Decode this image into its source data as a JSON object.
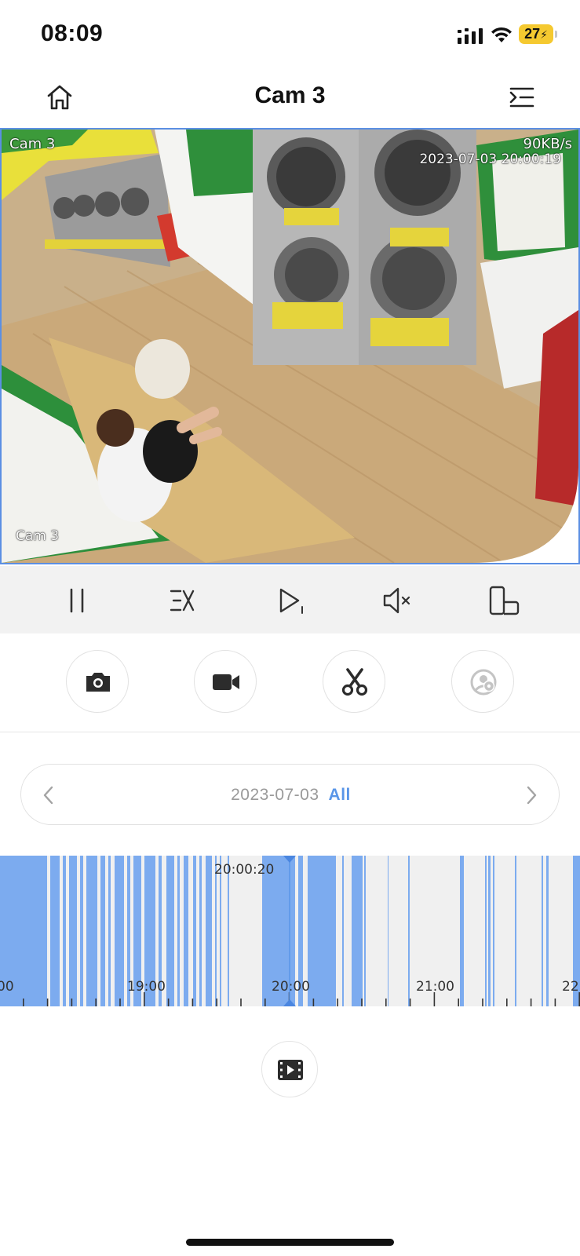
{
  "status_bar": {
    "time": "08:09",
    "battery_level": "27",
    "battery_color": "#f5c930",
    "icons": [
      "cellular-signal-icon",
      "wifi-icon",
      "battery-charging-icon"
    ]
  },
  "nav": {
    "title": "Cam 3",
    "left_icon": "home-icon",
    "right_icon": "menu-icon"
  },
  "camera": {
    "label_top_left": "Cam 3",
    "bitrate": "90KB/s",
    "timestamp": "2023-07-03 20:00:19",
    "label_bottom_left": "Cam 3",
    "border_color": "#5b8fe3"
  },
  "playback_controls": [
    {
      "name": "pause-icon"
    },
    {
      "name": "speed-icon"
    },
    {
      "name": "play-step-icon"
    },
    {
      "name": "mute-icon"
    },
    {
      "name": "rotate-screen-icon"
    }
  ],
  "tools": [
    {
      "name": "snapshot-camera-icon"
    },
    {
      "name": "record-video-icon"
    },
    {
      "name": "clip-scissors-icon"
    },
    {
      "name": "privacy-eye-icon",
      "disabled": true
    }
  ],
  "date_selector": {
    "date": "2023-07-03",
    "filter": "All",
    "accent_color": "#5a96e8"
  },
  "timeline": {
    "current_time": "20:00:20",
    "labels": [
      "00",
      "19:00",
      "20:00",
      "21:00",
      "22:"
    ],
    "fill_color": "#6fa3ee"
  },
  "clips_button": {
    "icon": "video-clips-icon"
  }
}
